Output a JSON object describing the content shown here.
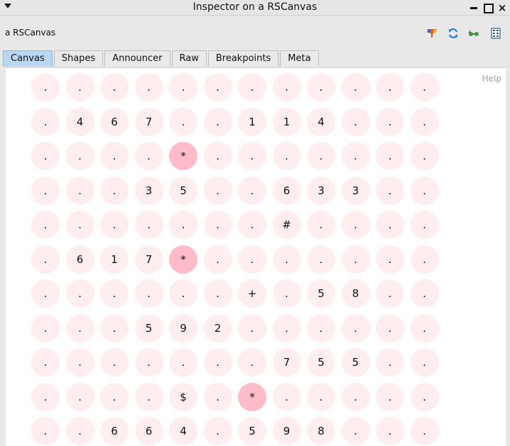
{
  "window": {
    "title": "Inspector on a RSCanvas"
  },
  "inspector": {
    "title": "a RSCanvas"
  },
  "tabs": [
    "Canvas",
    "Shapes",
    "Announcer",
    "Raw",
    "Breakpoints",
    "Meta"
  ],
  "active_tab": "Canvas",
  "canvas": {
    "help_label": "Help",
    "cell_color": "#ffedf0",
    "highlight_color": "#ffbcc8",
    "rows": [
      [
        ".",
        ".",
        ".",
        ".",
        ".",
        ".",
        ".",
        ".",
        ".",
        ".",
        ".",
        "."
      ],
      [
        ".",
        "4",
        "6",
        "7",
        ".",
        ".",
        "1",
        "1",
        "4",
        ".",
        ".",
        "."
      ],
      [
        ".",
        ".",
        ".",
        ".",
        "*",
        ".",
        ".",
        ".",
        ".",
        ".",
        ".",
        "."
      ],
      [
        ".",
        ".",
        ".",
        "3",
        "5",
        ".",
        ".",
        "6",
        "3",
        "3",
        ".",
        "."
      ],
      [
        ".",
        ".",
        ".",
        ".",
        ".",
        ".",
        ".",
        "#",
        ".",
        ".",
        ".",
        "."
      ],
      [
        ".",
        "6",
        "1",
        "7",
        "*",
        ".",
        ".",
        ".",
        ".",
        ".",
        ".",
        "."
      ],
      [
        ".",
        ".",
        ".",
        ".",
        ".",
        ".",
        "+",
        ".",
        "5",
        "8",
        ".",
        "."
      ],
      [
        ".",
        ".",
        ".",
        "5",
        "9",
        "2",
        ".",
        ".",
        ".",
        ".",
        ".",
        "."
      ],
      [
        ".",
        ".",
        ".",
        ".",
        ".",
        ".",
        ".",
        "7",
        "5",
        "5",
        ".",
        "."
      ],
      [
        ".",
        ".",
        ".",
        ".",
        "$",
        ".",
        "*",
        ".",
        ".",
        ".",
        ".",
        "."
      ],
      [
        ".",
        ".",
        "6",
        "6",
        "4",
        ".",
        "5",
        "9",
        "8",
        ".",
        ".",
        "."
      ]
    ]
  },
  "toolbar_icons": [
    "filter-icon",
    "refresh-icon",
    "glasses-icon",
    "table-icon"
  ]
}
